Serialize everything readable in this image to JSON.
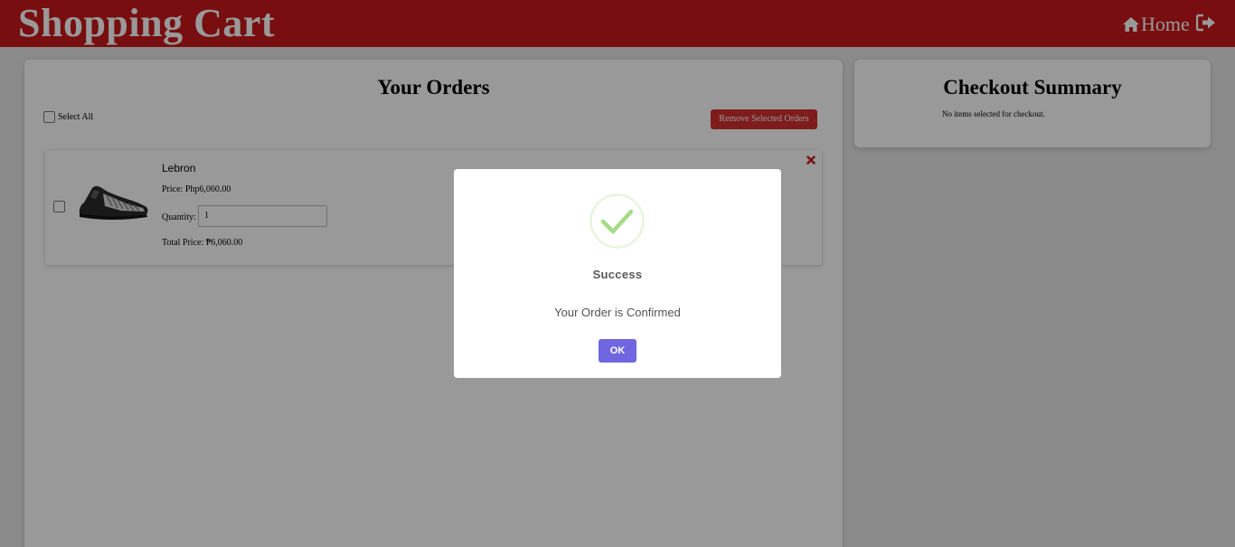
{
  "header": {
    "brand": "Shopping Cart",
    "home_label": "Home",
    "bg_color": "#c8181b",
    "icons": [
      "home-icon",
      "logout-icon"
    ]
  },
  "orders": {
    "title": "Your Orders",
    "select_all_label": "Select All",
    "remove_selected_label": "Remove Selected Orders",
    "items": [
      {
        "name": "Lebron",
        "price": "Price: Php6,060.00",
        "quantity_label": "Quantity:",
        "quantity_value": "1",
        "total_price": "Total Price: ₱6,060.00"
      }
    ]
  },
  "checkout": {
    "title": "Checkout Summary",
    "note": "No items selected for checkout."
  },
  "modal": {
    "title": "Success",
    "message": "Your Order is Confirmed",
    "ok_label": "OK",
    "accent_color": "#7066e0",
    "success_color": "#a5dc86"
  }
}
